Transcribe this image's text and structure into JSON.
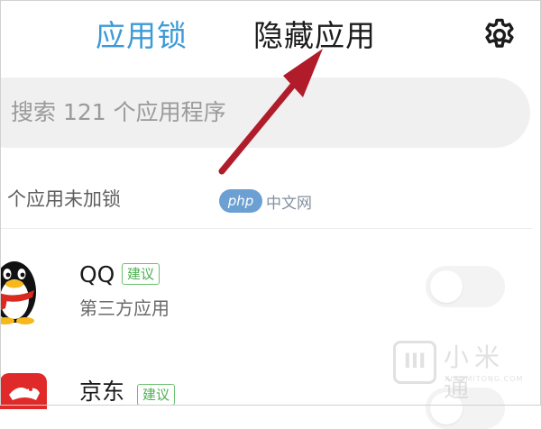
{
  "header": {
    "tab_lock": "应用锁",
    "tab_hidden": "隐藏应用",
    "settings_icon": "gear-icon"
  },
  "search": {
    "placeholder": "搜索 121 个应用程序"
  },
  "section": {
    "label": "个应用未加锁"
  },
  "apps": [
    {
      "name": "QQ",
      "badge": "建议",
      "subtitle": "第三方应用",
      "locked": false,
      "icon": "qq-penguin-icon"
    },
    {
      "name": "京东",
      "badge": "建议",
      "subtitle": "",
      "locked": false,
      "icon": "jd-app-icon"
    }
  ],
  "annotation": {
    "arrow_color": "#b01c2a",
    "icon": "red-arrow-icon"
  },
  "watermarks": {
    "center_logo": "php",
    "center_text": "中文网",
    "corner_mark": "III",
    "corner_text": "小米通",
    "corner_sub": "XIAOMITONG.COM"
  },
  "colors": {
    "accent_blue": "#3d9ad6",
    "badge_green": "#4caf50",
    "search_bg": "#f0f0f0"
  }
}
